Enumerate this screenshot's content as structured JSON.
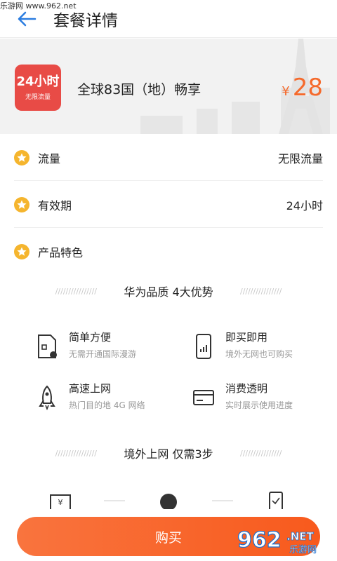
{
  "watermark": "乐游网 www.962.net",
  "header": {
    "title": "套餐详情",
    "back_icon": "back-arrow-icon",
    "accent": "#2b7de0"
  },
  "package": {
    "icon_main": "24小时",
    "icon_sub": "无限流量",
    "name": "全球83国（地）畅享",
    "price_symbol": "¥",
    "price": "28",
    "price_color": "#f56a2c"
  },
  "rows": [
    {
      "label": "流量",
      "value": "无限流量"
    },
    {
      "label": "有效期",
      "value": "24小时"
    },
    {
      "label": "产品特色",
      "value": ""
    }
  ],
  "section1": {
    "slashes": "////////////////",
    "title": "华为品质  4大优势"
  },
  "features": [
    {
      "icon": "sim-card-icon",
      "title": "简单方便",
      "subtitle": "无需开通国际漫游"
    },
    {
      "icon": "phone-signal-icon",
      "title": "即买即用",
      "subtitle": "境外无网也可购买"
    },
    {
      "icon": "rocket-icon",
      "title": "高速上网",
      "subtitle": "热门目的地 4G 网络"
    },
    {
      "icon": "card-icon",
      "title": "消费透明",
      "subtitle": "实时展示使用进度"
    }
  ],
  "section2": {
    "title": "境外上网  仅需3步"
  },
  "buy": {
    "label": "购买",
    "color": "#f85a1d"
  },
  "logo": {
    "text": "962",
    "suffix": ".NET",
    "sub": "乐游网"
  }
}
